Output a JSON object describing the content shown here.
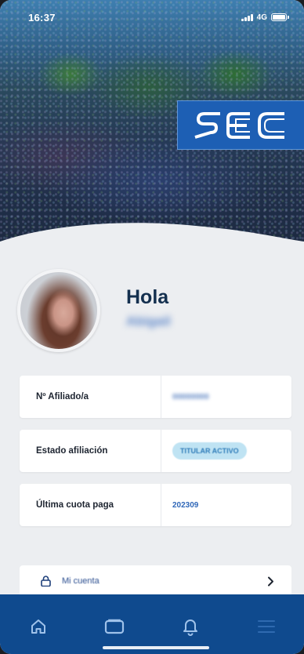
{
  "status_bar": {
    "time": "16:37",
    "network": "4G"
  },
  "brand": {
    "logo_text": "SEC",
    "primary_color": "#1d5fb4",
    "nav_color": "#0f4a8e"
  },
  "profile": {
    "greeting": "Hola",
    "user_name": "Abigail"
  },
  "info_cards": [
    {
      "label": "Nº Afiliado/a",
      "value": "00000000"
    },
    {
      "label": "Estado afiliación",
      "value": "TITULAR ACTIVO"
    },
    {
      "label": "Última cuota paga",
      "value": "202309"
    }
  ],
  "menu": {
    "account_label": "Mi cuenta",
    "account_icon": "lock-icon",
    "chevron_icon": "chevron-right-icon"
  },
  "bottom_nav": [
    {
      "icon": "home-icon"
    },
    {
      "icon": "card-icon"
    },
    {
      "icon": "bell-icon"
    },
    {
      "icon": "menu-icon"
    }
  ]
}
